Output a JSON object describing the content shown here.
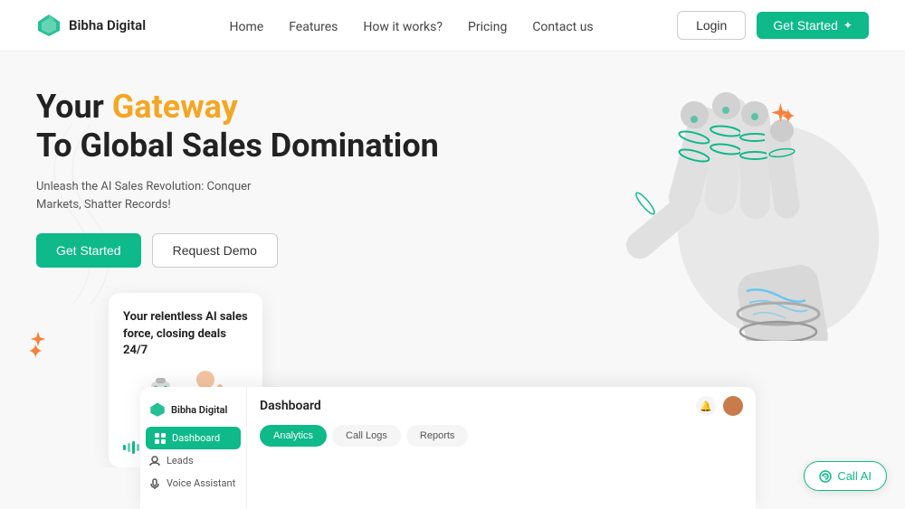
{
  "navbar": {
    "logo_text": "Bibha Digital",
    "links": [
      "Home",
      "Features",
      "How it works?",
      "Pricing",
      "Contact us"
    ],
    "login_label": "Login",
    "get_started_label": "Get Started"
  },
  "hero": {
    "title_part1": "Your ",
    "title_gateway": "Gateway",
    "title_line2": "To Global Sales Domination",
    "subtitle": "Unleash the AI Sales Revolution: Conquer Markets, Shatter Records!",
    "btn_get_started": "Get Started",
    "btn_request_demo": "Request Demo",
    "ai_card_text": "Your relentless AI sales force, closing deals 24/7"
  },
  "dashboard": {
    "title": "Dashboard",
    "logo_text": "Bibha Digital",
    "tabs": [
      {
        "label": "Analytics",
        "active": true
      },
      {
        "label": "Call Logs",
        "active": false
      },
      {
        "label": "Reports",
        "active": false
      }
    ],
    "nav_items": [
      {
        "label": "Dashboard",
        "active": true
      },
      {
        "label": "Leads",
        "active": false
      },
      {
        "label": "Voice Assistant",
        "active": false
      }
    ]
  },
  "call_ai": {
    "label": "Call AI"
  }
}
